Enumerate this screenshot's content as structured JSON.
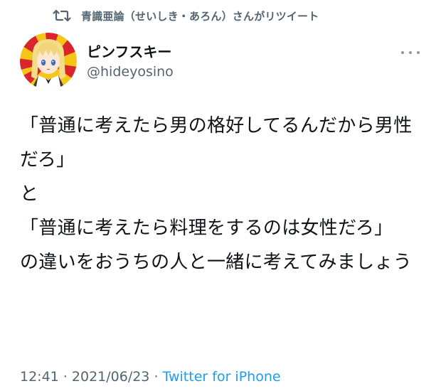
{
  "retweet": {
    "icon": "retweet-icon",
    "text": "青識亜論（せいしき・あろん）さんがリツイート"
  },
  "author": {
    "avatar_icon": "anime-avatar-icon",
    "display_name": "ピンフスキー",
    "handle": "@hideyosino"
  },
  "tweet": {
    "text": "「普通に考えたら男の格好してるんだから男性だろ」\nと\n「普通に考えたら料理をするのは女性だろ」\nの違いをおうちの人と一緒に考えてみましょう"
  },
  "meta": {
    "time": "12:41",
    "separator1": " · ",
    "date": "2021/06/23",
    "separator2": " · ",
    "source": "Twitter for iPhone"
  },
  "menu": {
    "icon": "more-icon"
  },
  "colors": {
    "text": "#0f1419",
    "secondary": "#536471",
    "link": "#1d9bf0",
    "avatar_ray_red": "#d9262c",
    "avatar_ray_yellow": "#f5c518"
  }
}
